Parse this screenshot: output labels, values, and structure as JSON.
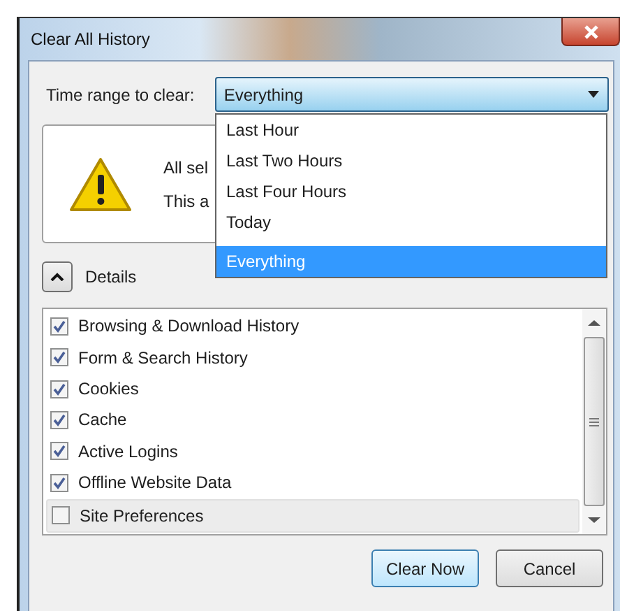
{
  "window": {
    "title": "Clear All History"
  },
  "time_range": {
    "label": "Time range to clear:",
    "value": "Everything",
    "expanded": true,
    "options": [
      {
        "label": "Last Hour",
        "selected": false
      },
      {
        "label": "Last Two Hours",
        "selected": false
      },
      {
        "label": "Last Four Hours",
        "selected": false
      },
      {
        "label": "Today",
        "selected": false
      },
      {
        "label": "Everything",
        "selected": true
      }
    ]
  },
  "warning": {
    "lines": [
      "All sel",
      "This a"
    ]
  },
  "details": {
    "label": "Details",
    "expanded": true
  },
  "items": [
    {
      "label": "Browsing & Download History",
      "checked": true,
      "selected": false
    },
    {
      "label": "Form & Search History",
      "checked": true,
      "selected": false
    },
    {
      "label": "Cookies",
      "checked": true,
      "selected": false
    },
    {
      "label": "Cache",
      "checked": true,
      "selected": false
    },
    {
      "label": "Active Logins",
      "checked": true,
      "selected": false
    },
    {
      "label": "Offline Website Data",
      "checked": true,
      "selected": false
    },
    {
      "label": "Site Preferences",
      "checked": false,
      "selected": true
    }
  ],
  "buttons": [
    {
      "label": "Clear Now",
      "default": true
    },
    {
      "label": "Cancel",
      "default": false
    }
  ]
}
